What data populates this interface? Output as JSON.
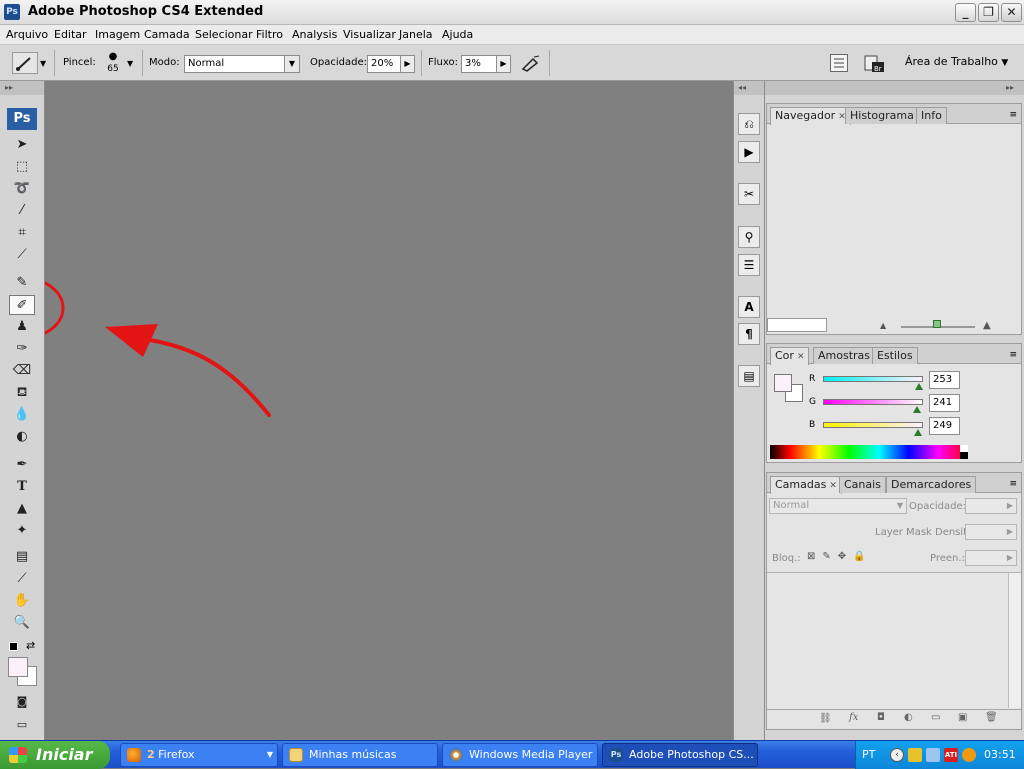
{
  "window": {
    "title": "Adobe Photoshop CS4 Extended",
    "app_icon": "Ps",
    "controls": [
      "_",
      "❐",
      "✕"
    ]
  },
  "menu": [
    "Arquivo",
    "Editar",
    "Imagem",
    "Camada",
    "Selecionar",
    "Filtro",
    "Analysis",
    "Visualizar",
    "Janela",
    "Ajuda"
  ],
  "options": {
    "brush_label": "Pincel:",
    "brush_size": "65",
    "mode_label": "Modo:",
    "mode_value": "Normal",
    "opacity_label": "Opacidade:",
    "opacity_value": "20%",
    "flow_label": "Fluxo:",
    "flow_value": "3%",
    "workspace": "Área de Trabalho"
  },
  "toolbox": {
    "logo": "Ps"
  },
  "navigator": {
    "tabs": [
      "Navegador",
      "Histograma",
      "Info"
    ]
  },
  "color": {
    "tabs": [
      "Cor",
      "Amostras",
      "Estilos"
    ],
    "channels": [
      {
        "label": "R",
        "value": "253"
      },
      {
        "label": "G",
        "value": "241"
      },
      {
        "label": "B",
        "value": "249"
      }
    ],
    "foreground": "#fdf1f9"
  },
  "layers": {
    "tabs": [
      "Camadas",
      "Canais",
      "Demarcadores"
    ],
    "blend_mode": "Normal",
    "opacity_label": "Opacidade:",
    "mask_density_label": "Layer Mask Density",
    "lock_label": "Bloq.:",
    "fill_label": "Preen.:"
  },
  "taskbar": {
    "start": "Iniciar",
    "tasks": [
      {
        "count": "2",
        "label": "Firefox"
      },
      {
        "label": "Minhas músicas"
      },
      {
        "label": "Windows Media Player"
      },
      {
        "label": "Adobe Photoshop CS..."
      }
    ],
    "lang": "PT",
    "clock": "03:51"
  },
  "colors": {
    "annotation": "#e31414",
    "canvas": "#808080",
    "taskbar": "#245edb"
  }
}
